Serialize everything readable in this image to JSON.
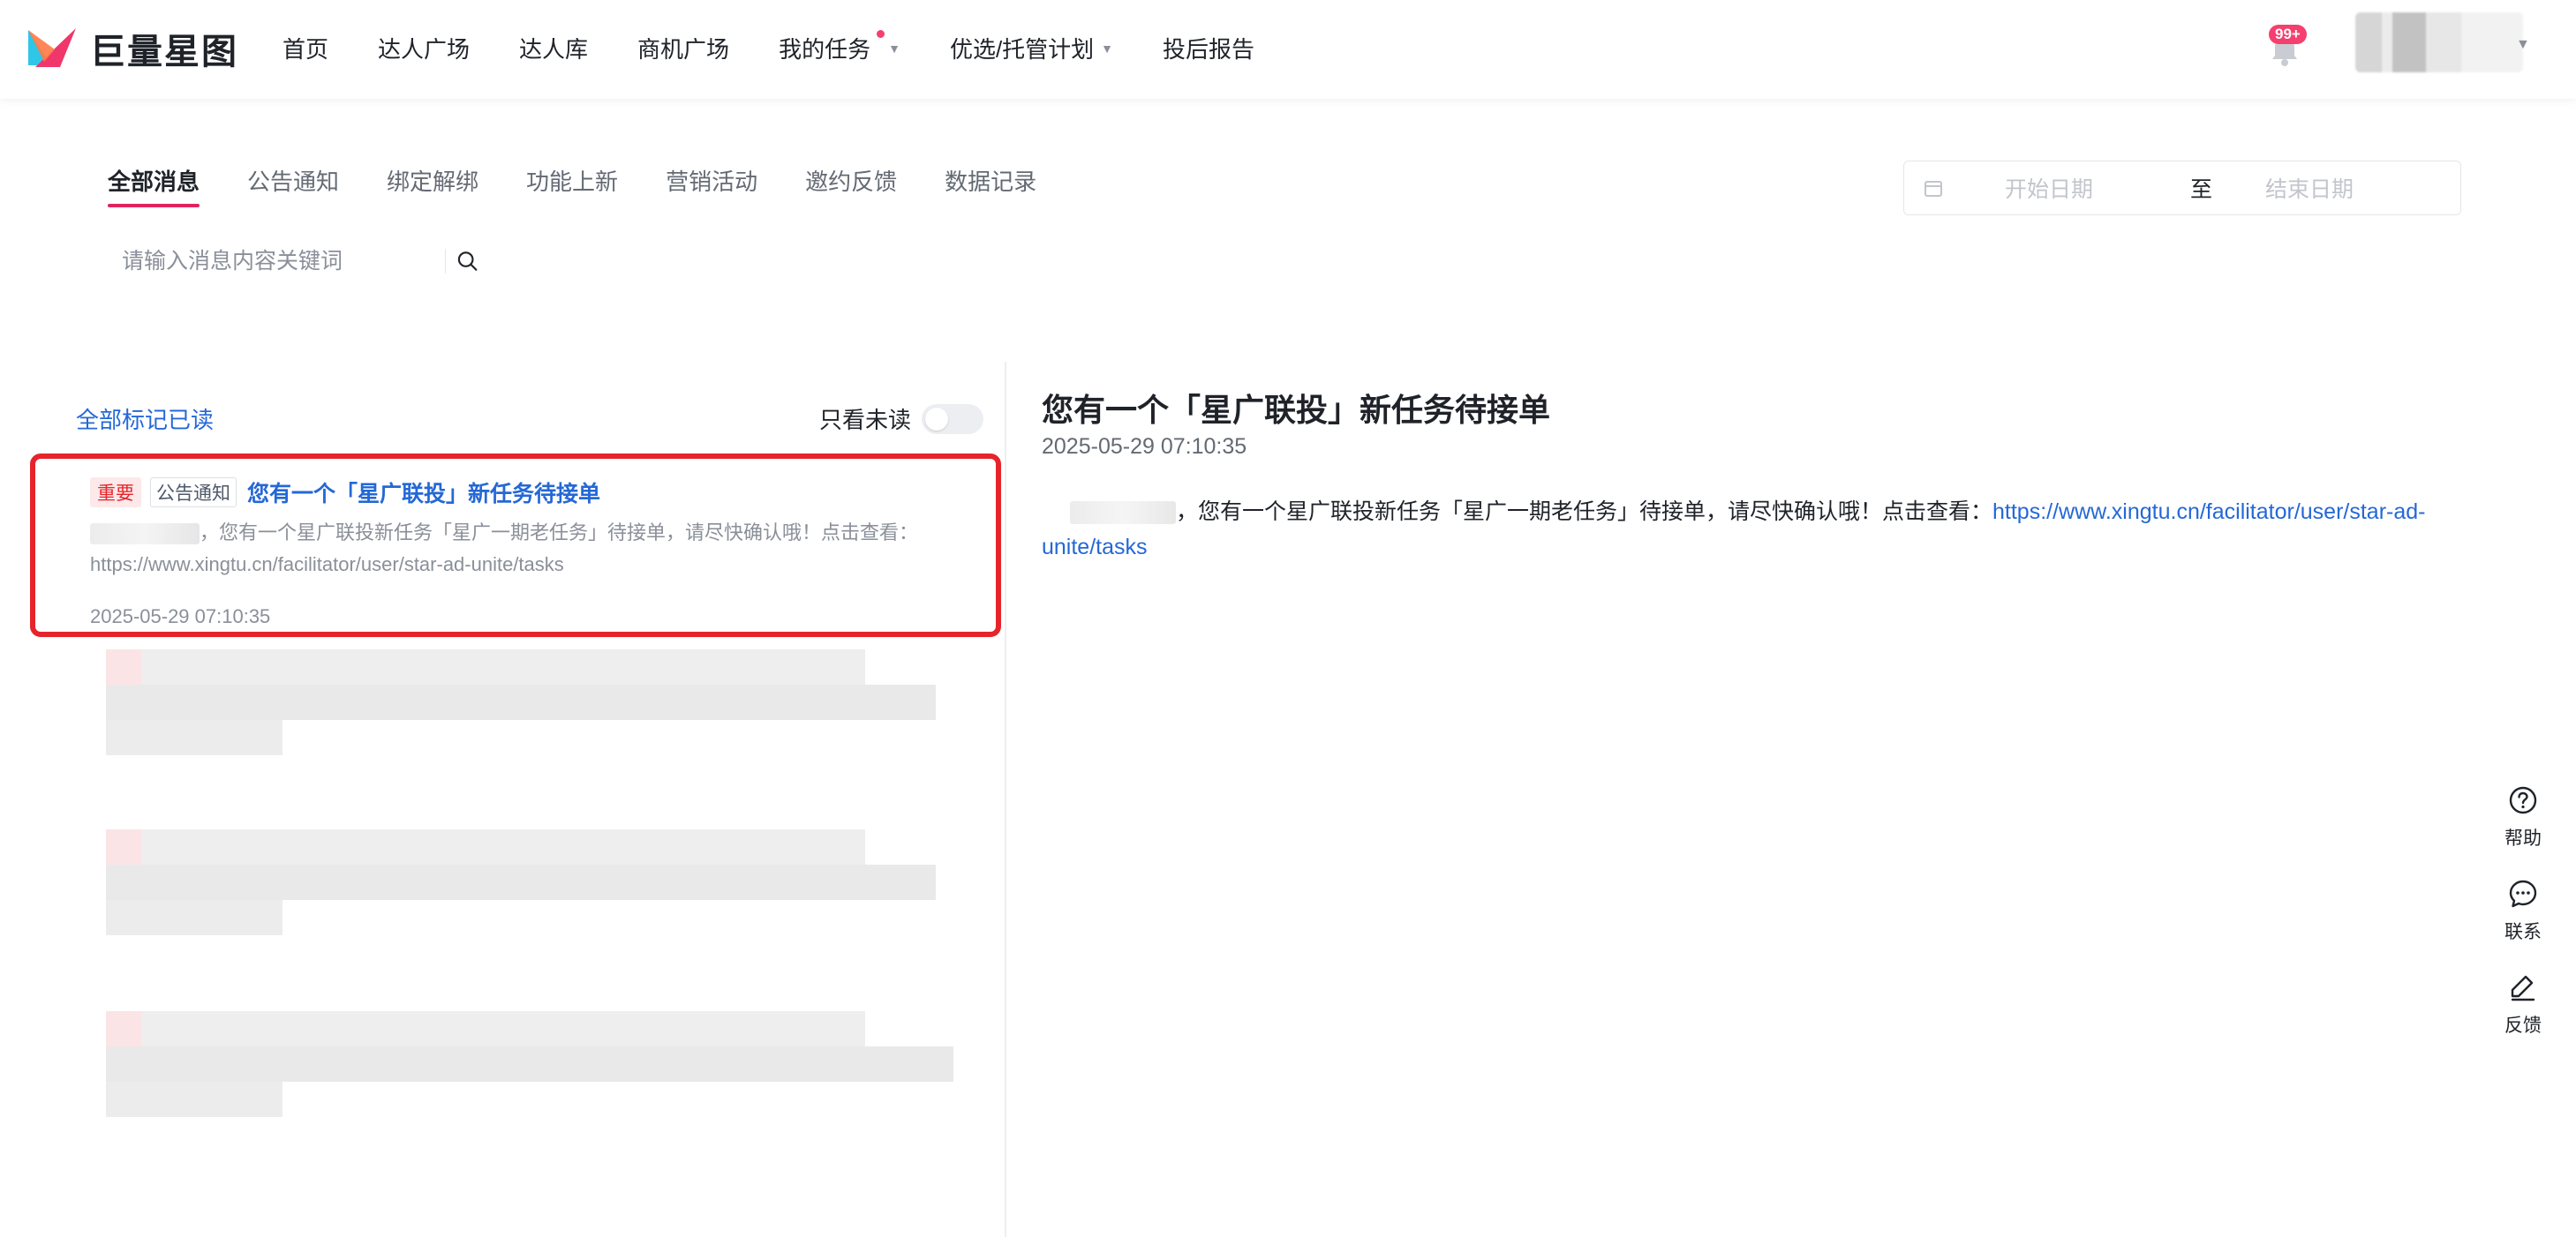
{
  "app": {
    "brand": "巨量星图",
    "notification_badge": "99+",
    "colors": {
      "accent": "#e0245e",
      "link": "#2468d6",
      "highlight_border": "#e5252b"
    }
  },
  "nav": {
    "items": [
      {
        "label": "首页"
      },
      {
        "label": "达人广场"
      },
      {
        "label": "达人库"
      },
      {
        "label": "商机广场"
      },
      {
        "label": "我的任务",
        "dot": true,
        "dropdown": true
      },
      {
        "label": "优选/托管计划",
        "dropdown": true
      },
      {
        "label": "投后报告"
      }
    ]
  },
  "tabs": [
    {
      "label": "全部消息",
      "active": true
    },
    {
      "label": "公告通知"
    },
    {
      "label": "绑定解绑"
    },
    {
      "label": "功能上新"
    },
    {
      "label": "营销活动"
    },
    {
      "label": "邀约反馈"
    },
    {
      "label": "数据记录"
    }
  ],
  "date_range": {
    "start_placeholder": "开始日期",
    "separator": "至",
    "end_placeholder": "结束日期"
  },
  "search": {
    "placeholder": "请输入消息内容关键词"
  },
  "list": {
    "mark_all_read": "全部标记已读",
    "only_unread": "只看未读",
    "messages": [
      {
        "tag_important": "重要",
        "tag_category": "公告通知",
        "title": "您有一个「星广联投」新任务待接单",
        "body": "，您有一个星广联投新任务「星广一期老任务」待接单，请尽快确认哦！点击查看：https://www.xingtu.cn/facilitator/user/star-ad-unite/tasks",
        "time": "2025-05-29 07:10:35"
      }
    ]
  },
  "detail": {
    "title": "您有一个「星广联投」新任务待接单",
    "time": "2025-05-29 07:10:35",
    "body": "，您有一个星广联投新任务「星广一期老任务」待接单，请尽快确认哦！点击查看：",
    "link": "https://www.xingtu.cn/facilitator/user/star-ad-unite/tasks"
  },
  "float_tools": [
    {
      "label": "帮助",
      "icon": "help-icon"
    },
    {
      "label": "联系",
      "icon": "chat-icon"
    },
    {
      "label": "反馈",
      "icon": "edit-icon"
    }
  ]
}
